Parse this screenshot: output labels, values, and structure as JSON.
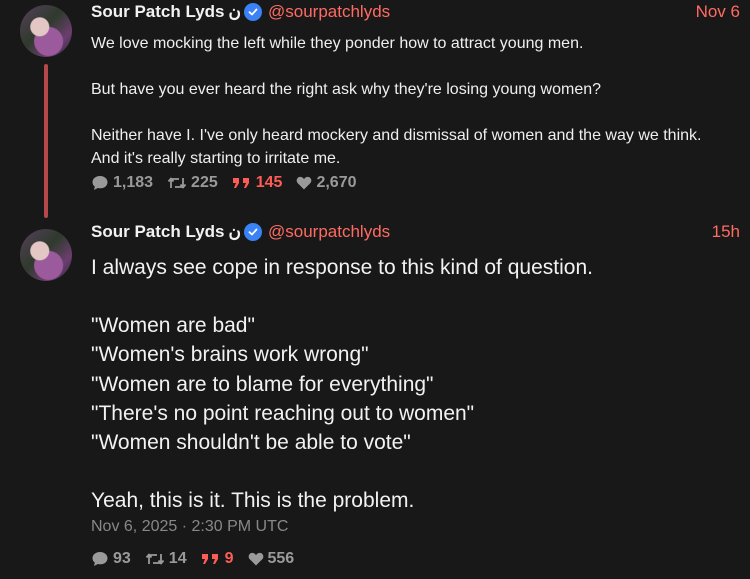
{
  "tweets": [
    {
      "name": "Sour Patch Lyds",
      "name_suffix": "ن",
      "handle": "@sourpatchlyds",
      "time": "Nov 6",
      "paragraphs": [
        "We love mocking the left while they ponder how to attract young men.",
        "But have you ever heard the right ask why they're losing young women?",
        "Neither have I. I've only heard mockery and dismissal of women and the way we think. And it's really starting to irritate me."
      ],
      "stats": {
        "replies": "1,183",
        "retweets": "225",
        "quotes": "145",
        "likes": "2,670"
      }
    },
    {
      "name": "Sour Patch Lyds",
      "name_suffix": "ن",
      "handle": "@sourpatchlyds",
      "time": "15h",
      "intro": "I always see cope in response to this kind of question.",
      "quotes": [
        "\"Women are bad\"",
        "\"Women's brains work wrong\"",
        "\"Women are to blame for everything\"",
        "\"There's no point reaching out to women\"",
        "\"Women shouldn't be able to vote\""
      ],
      "outro": "Yeah, this is it. This is the problem.",
      "timestamp": "Nov 6, 2025 · 2:30 PM UTC",
      "stats": {
        "replies": "93",
        "retweets": "14",
        "quotes": "9",
        "likes": "556"
      }
    }
  ],
  "colors": {
    "accent": "#ff6b62",
    "verified": "#3b82f6",
    "thread_line": "#b5484a",
    "background": "#181818"
  }
}
